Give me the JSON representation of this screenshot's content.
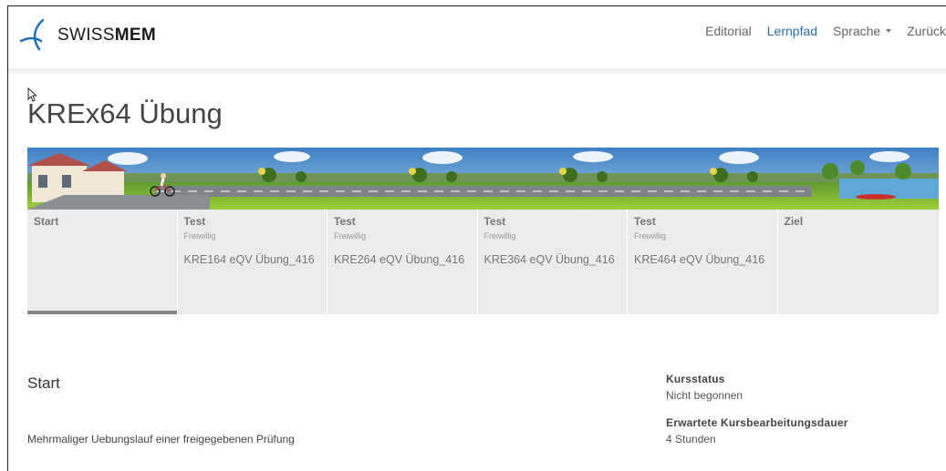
{
  "brand": {
    "logo_text_light": "SWISS",
    "logo_text_bold": "MEM",
    "brand_color": "#1f6fb5"
  },
  "nav": {
    "items": [
      {
        "label": "Editorial",
        "active": false
      },
      {
        "label": "Lernpfad",
        "active": true
      },
      {
        "label": "Sprache",
        "dropdown": true,
        "active": false
      },
      {
        "label": "Zurück",
        "active": false
      }
    ]
  },
  "page": {
    "title": "KREx64 Übung"
  },
  "stages": [
    {
      "name": "Start",
      "type": "",
      "link": "",
      "progress": 1.0
    },
    {
      "name": "Test",
      "type": "Freiwillig",
      "link": "KRE164 eQV Übung_416",
      "progress": 0
    },
    {
      "name": "Test",
      "type": "Freiwillig",
      "link": "KRE264 eQV Übung_416",
      "progress": 0
    },
    {
      "name": "Test",
      "type": "Freiwillig",
      "link": "KRE364 eQV Übung_416",
      "progress": 0
    },
    {
      "name": "Test",
      "type": "Freiwillig",
      "link": "KRE464 eQV Übung_416",
      "progress": 0
    },
    {
      "name": "Ziel",
      "type": "",
      "link": "",
      "progress": 0
    }
  ],
  "content": {
    "section_title": "Start",
    "description": "Mehrmaliger Uebungslauf einer freigegebenen Prüfung"
  },
  "course_info": {
    "status_label": "Kursstatus",
    "status_value": "Nicht begonnen",
    "duration_label": "Erwartete Kursbearbeitungsdauer",
    "duration_value": "4 Stunden"
  },
  "colors": {
    "nav_active": "#2a6fb0",
    "stage_bg": "#ebebeb",
    "progress": "#888888"
  }
}
